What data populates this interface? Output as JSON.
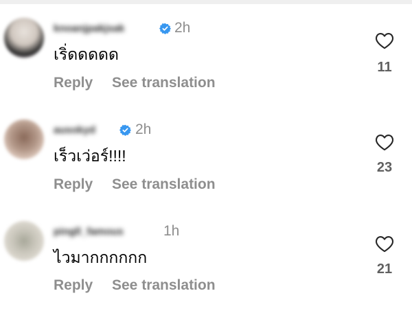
{
  "comments": [
    {
      "username": "knoanjpakjsak",
      "verified": true,
      "time": "2h",
      "text": "เริ่ดดดดด",
      "reply_label": "Reply",
      "translate_label": "See translation",
      "likes": "11",
      "avatar_color": "#d9cfc4"
    },
    {
      "username": "ausokyd",
      "verified": true,
      "time": "2h",
      "text": "เร็วเว่อร์!!!!",
      "reply_label": "Reply",
      "translate_label": "See translation",
      "likes": "23",
      "avatar_color": "#b89a86"
    },
    {
      "username": "pingll_famous",
      "verified": false,
      "time": "1h",
      "text": "ไวมากกกกกก",
      "reply_label": "Reply",
      "translate_label": "See translation",
      "likes": "21",
      "avatar_color": "#c8c4b8"
    }
  ],
  "colors": {
    "verified_blue": "#3897f0",
    "secondary_text": "#8e8e8e",
    "divider": "#efefef"
  }
}
